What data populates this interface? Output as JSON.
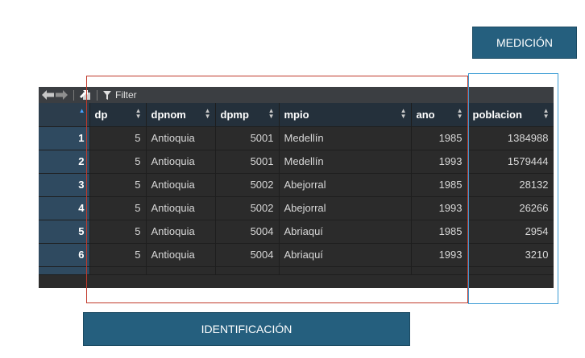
{
  "labels": {
    "medicion": "MEDICIÓN",
    "identificacion": "IDENTIFICACIÓN"
  },
  "toolbar": {
    "filter_label": "Filter",
    "icons": [
      "back-arrow-icon",
      "forward-arrow-icon",
      "popout-icon",
      "filter-icon"
    ]
  },
  "table": {
    "columns": [
      "dp",
      "dpnom",
      "dpmp",
      "mpio",
      "ano",
      "poblacion"
    ],
    "rows": [
      {
        "n": "1",
        "dp": "5",
        "dpnom": "Antioquia",
        "dpmp": "5001",
        "mpio": "Medellín",
        "ano": "1985",
        "poblacion": "1384988"
      },
      {
        "n": "2",
        "dp": "5",
        "dpnom": "Antioquia",
        "dpmp": "5001",
        "mpio": "Medellín",
        "ano": "1993",
        "poblacion": "1579444"
      },
      {
        "n": "3",
        "dp": "5",
        "dpnom": "Antioquia",
        "dpmp": "5002",
        "mpio": "Abejorral",
        "ano": "1985",
        "poblacion": "28132"
      },
      {
        "n": "4",
        "dp": "5",
        "dpnom": "Antioquia",
        "dpmp": "5002",
        "mpio": "Abejorral",
        "ano": "1993",
        "poblacion": "26266"
      },
      {
        "n": "5",
        "dp": "5",
        "dpnom": "Antioquia",
        "dpmp": "5004",
        "mpio": "Abriaquí",
        "ano": "1985",
        "poblacion": "2954"
      },
      {
        "n": "6",
        "dp": "5",
        "dpnom": "Antioquia",
        "dpmp": "5004",
        "mpio": "Abriaquí",
        "ano": "1993",
        "poblacion": "3210"
      }
    ]
  },
  "colors": {
    "label_bg": "#255f7e",
    "identification_outline": "#c0392b",
    "measurement_outline": "#3a9bd4",
    "grid_bg": "#2b2b2b",
    "header_bg": "#24303b",
    "rownum_bg": "#2f4a60"
  }
}
